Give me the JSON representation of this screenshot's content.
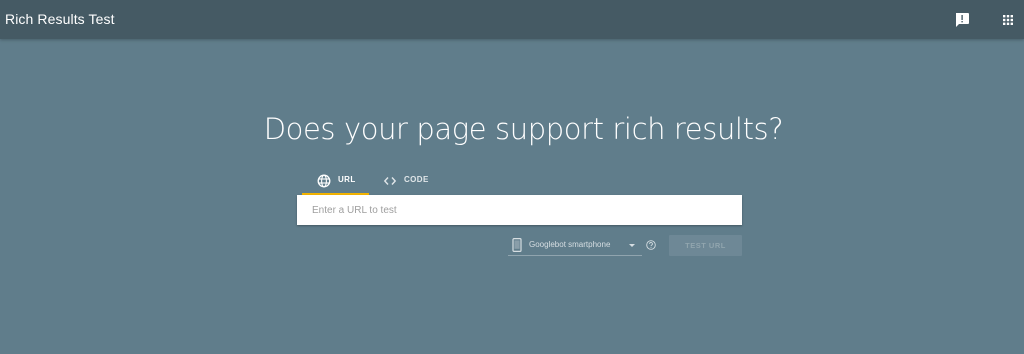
{
  "header": {
    "title": "Rich Results Test",
    "feedback_icon": "feedback-icon",
    "apps_icon": "apps-grid-icon"
  },
  "main": {
    "headline": "Does your page support rich results?",
    "tabs": [
      {
        "label": "URL",
        "icon": "globe-icon",
        "active": true
      },
      {
        "label": "CODE",
        "icon": "code-icon",
        "active": false
      }
    ],
    "url_input": {
      "placeholder": "Enter a URL to test",
      "value": ""
    },
    "user_agent": {
      "selected": "Googlebot smartphone",
      "icon": "smartphone-icon"
    },
    "help_icon": "help-icon",
    "test_button": {
      "label": "TEST URL",
      "enabled": false
    }
  },
  "colors": {
    "header_bg": "#455a64",
    "page_bg": "#607d8b",
    "tab_accent": "#f4b400",
    "button_disabled_bg": "#6e8896"
  }
}
